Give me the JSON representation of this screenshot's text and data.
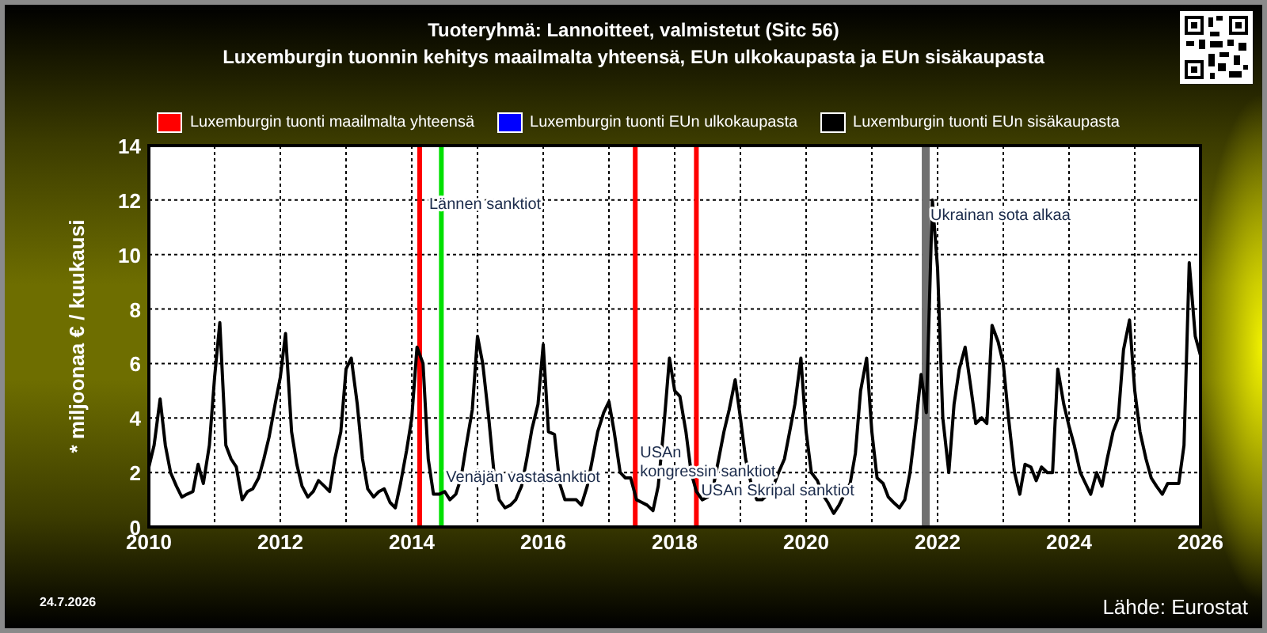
{
  "header": {
    "title": "Tuoteryhmä: Lannoitteet, valmistetut (Sitc 56)",
    "subtitle": "Luxemburgin tuonnin kehitys maailmalta yhteensä, EUn ulkokaupasta ja EUn sisäkaupasta"
  },
  "chart": {
    "chart_data": {
      "type": "line",
      "grid": true,
      "ylabel": "* miljoonaa € / kuukausi",
      "xlim": [
        2010,
        2026
      ],
      "ylim": [
        0,
        14
      ],
      "xticks": [
        2010,
        2012,
        2014,
        2016,
        2018,
        2020,
        2022,
        2024,
        2026
      ],
      "yticks": [
        0,
        2,
        4,
        6,
        8,
        10,
        12,
        14
      ],
      "x": [
        2010,
        2010.08,
        2010.17,
        2010.25,
        2010.33,
        2010.42,
        2010.5,
        2010.58,
        2010.67,
        2010.75,
        2010.83,
        2010.92,
        2011,
        2011.08,
        2011.17,
        2011.25,
        2011.33,
        2011.42,
        2011.5,
        2011.58,
        2011.67,
        2011.75,
        2011.83,
        2011.92,
        2012,
        2012.08,
        2012.17,
        2012.25,
        2012.33,
        2012.42,
        2012.5,
        2012.58,
        2012.67,
        2012.75,
        2012.83,
        2012.92,
        2013,
        2013.08,
        2013.17,
        2013.25,
        2013.33,
        2013.42,
        2013.5,
        2013.58,
        2013.67,
        2013.75,
        2013.83,
        2013.92,
        2014,
        2014.08,
        2014.17,
        2014.25,
        2014.33,
        2014.42,
        2014.5,
        2014.58,
        2014.67,
        2014.75,
        2014.83,
        2014.92,
        2015,
        2015.08,
        2015.17,
        2015.25,
        2015.33,
        2015.42,
        2015.5,
        2015.58,
        2015.67,
        2015.75,
        2015.83,
        2015.92,
        2016,
        2016.08,
        2016.17,
        2016.25,
        2016.33,
        2016.42,
        2016.5,
        2016.58,
        2016.67,
        2016.75,
        2016.83,
        2016.92,
        2017,
        2017.08,
        2017.17,
        2017.25,
        2017.33,
        2017.42,
        2017.5,
        2017.58,
        2017.67,
        2017.75,
        2017.83,
        2017.92,
        2018,
        2018.08,
        2018.17,
        2018.25,
        2018.33,
        2018.42,
        2018.5,
        2018.58,
        2018.67,
        2018.75,
        2018.83,
        2018.92,
        2019,
        2019.08,
        2019.17,
        2019.25,
        2019.33,
        2019.42,
        2019.5,
        2019.58,
        2019.67,
        2019.75,
        2019.83,
        2019.92,
        2020,
        2020.08,
        2020.17,
        2020.25,
        2020.33,
        2020.42,
        2020.5,
        2020.58,
        2020.67,
        2020.75,
        2020.83,
        2020.92,
        2021,
        2021.08,
        2021.17,
        2021.25,
        2021.33,
        2021.42,
        2021.5,
        2021.58,
        2021.67,
        2021.75,
        2021.83,
        2021.92,
        2022,
        2022.08,
        2022.17,
        2022.25,
        2022.33,
        2022.42,
        2022.5,
        2022.58,
        2022.67,
        2022.75,
        2022.83,
        2022.92,
        2023,
        2023.08,
        2023.17,
        2023.25,
        2023.33,
        2023.42,
        2023.5,
        2023.58,
        2023.67,
        2023.75,
        2023.83,
        2023.92,
        2024,
        2024.08,
        2024.17,
        2024.25,
        2024.33,
        2024.42,
        2024.5,
        2024.58,
        2024.67,
        2024.75,
        2024.83,
        2024.92,
        2025,
        2025.08,
        2025.17,
        2025.25,
        2025.33,
        2025.42,
        2025.5,
        2025.58,
        2025.67,
        2025.75,
        2025.83,
        2025.92,
        2026
      ],
      "series": [
        {
          "name": "Luxemburgin tuonti maailmalta yhteensä",
          "color": "#ff0000",
          "values": [
            null,
            null,
            null,
            null,
            null,
            null,
            null,
            null,
            null,
            null,
            null,
            null,
            null,
            null,
            null,
            null,
            null,
            null,
            null,
            null,
            null,
            null,
            null,
            null,
            null,
            null,
            null,
            null,
            null,
            null,
            null,
            null,
            null,
            null,
            null,
            null,
            null,
            null,
            null,
            null,
            null,
            null,
            null,
            null,
            null,
            null,
            null,
            null,
            null,
            null,
            null,
            null,
            null,
            null,
            null,
            null,
            null,
            null,
            null,
            null,
            null,
            null,
            null,
            null,
            null,
            null,
            null,
            null,
            null,
            null,
            null,
            null,
            null,
            null,
            null,
            null,
            null,
            null,
            null,
            null,
            null,
            null,
            null,
            null,
            null,
            null,
            null,
            null,
            null,
            null,
            null,
            null,
            null,
            null,
            null,
            null,
            null,
            null,
            null,
            null,
            null,
            null,
            null,
            null,
            null,
            null,
            null,
            null,
            null,
            null,
            null,
            null,
            null,
            null,
            null,
            null,
            null,
            null,
            null,
            null,
            null,
            null,
            null,
            null,
            null,
            null,
            null,
            null,
            null,
            null,
            null,
            null,
            null,
            null,
            null,
            null,
            null,
            null,
            null,
            null,
            null,
            null,
            null,
            null,
            null,
            null,
            null,
            null,
            null,
            null,
            null,
            null,
            null,
            null,
            null,
            null,
            null,
            null,
            null,
            null,
            null,
            null,
            null,
            null,
            null,
            null,
            null,
            null,
            null,
            null,
            null,
            null,
            null,
            null,
            null,
            null,
            null,
            null,
            null,
            null,
            null,
            null,
            null,
            null,
            null,
            null,
            null,
            null,
            null,
            null,
            null,
            null,
            null
          ]
        },
        {
          "name": "Luxemburgin tuonti EUn ulkokaupasta",
          "color": "#0000ff",
          "values": [
            null,
            null,
            null,
            null,
            null,
            null,
            null,
            null,
            null,
            null,
            null,
            null,
            null,
            null,
            null,
            null,
            null,
            null,
            null,
            null,
            null,
            null,
            null,
            null,
            null,
            null,
            null,
            null,
            null,
            null,
            null,
            null,
            null,
            null,
            null,
            null,
            null,
            null,
            null,
            null,
            null,
            null,
            null,
            null,
            null,
            null,
            null,
            null,
            null,
            null,
            null,
            null,
            null,
            null,
            null,
            null,
            null,
            null,
            null,
            null,
            null,
            null,
            null,
            null,
            null,
            null,
            null,
            null,
            null,
            null,
            null,
            null,
            null,
            null,
            null,
            null,
            null,
            null,
            null,
            null,
            null,
            null,
            null,
            null,
            null,
            null,
            null,
            null,
            null,
            null,
            null,
            null,
            null,
            null,
            null,
            null,
            null,
            null,
            null,
            null,
            null,
            null,
            null,
            null,
            null,
            null,
            null,
            null,
            null,
            null,
            null,
            null,
            null,
            null,
            null,
            null,
            null,
            null,
            null,
            null,
            null,
            null,
            null,
            null,
            null,
            null,
            null,
            null,
            null,
            null,
            null,
            null,
            null,
            null,
            null,
            null,
            null,
            null,
            null,
            null,
            null,
            null,
            null,
            null,
            null,
            null,
            null,
            null,
            null,
            null,
            null,
            null,
            null,
            null,
            null,
            null,
            null,
            null,
            null,
            null,
            null,
            null,
            null,
            null,
            null,
            null,
            null,
            null,
            null,
            null,
            null,
            null,
            null,
            null,
            null,
            null,
            null,
            null,
            null,
            null,
            null,
            null,
            null,
            null,
            null,
            null,
            null,
            null,
            null,
            null,
            null,
            null,
            null
          ]
        },
        {
          "name": "Luxemburgin tuonti EUn sisäkaupasta",
          "color": "#000000",
          "values": [
            2.2,
            3.0,
            4.7,
            3.0,
            2.0,
            1.5,
            1.1,
            1.2,
            1.3,
            2.3,
            1.6,
            3.0,
            5.5,
            7.5,
            3.0,
            2.5,
            2.2,
            1.0,
            1.3,
            1.4,
            1.8,
            2.5,
            3.3,
            4.5,
            5.5,
            7.1,
            3.5,
            2.3,
            1.5,
            1.1,
            1.3,
            1.7,
            1.5,
            1.3,
            2.5,
            3.5,
            5.8,
            6.2,
            4.5,
            2.5,
            1.4,
            1.1,
            1.3,
            1.4,
            0.9,
            0.7,
            1.6,
            2.8,
            4.0,
            6.6,
            6.0,
            2.5,
            1.2,
            1.2,
            1.3,
            1.0,
            1.2,
            1.8,
            3.0,
            4.3,
            7.0,
            6.0,
            4.0,
            2.0,
            1.0,
            0.7,
            0.8,
            1.0,
            1.5,
            2.5,
            3.6,
            4.5,
            6.7,
            3.5,
            3.4,
            1.6,
            1.0,
            1.0,
            1.0,
            0.8,
            1.5,
            2.5,
            3.5,
            4.2,
            4.6,
            3.5,
            2.0,
            1.8,
            1.8,
            1.0,
            0.9,
            0.8,
            0.6,
            1.5,
            3.5,
            6.2,
            5.0,
            4.8,
            3.5,
            2.0,
            1.3,
            1.0,
            1.1,
            1.4,
            2.5,
            3.5,
            4.3,
            5.4,
            4.0,
            2.5,
            1.5,
            1.0,
            1.0,
            1.2,
            1.5,
            2.0,
            2.5,
            3.5,
            4.5,
            6.2,
            3.5,
            2.0,
            1.7,
            1.2,
            0.9,
            0.5,
            0.8,
            1.2,
            1.6,
            2.7,
            5.0,
            6.2,
            3.5,
            1.8,
            1.6,
            1.1,
            0.9,
            0.7,
            1.0,
            2.0,
            3.8,
            5.6,
            4.2,
            12.0,
            9.5,
            4.0,
            2.0,
            4.5,
            5.8,
            6.6,
            5.2,
            3.8,
            4.0,
            3.8,
            7.4,
            6.8,
            6.0,
            4.0,
            2.0,
            1.2,
            2.3,
            2.2,
            1.7,
            2.2,
            2.0,
            2.0,
            5.8,
            4.5,
            3.7,
            3.0,
            2.0,
            1.6,
            1.2,
            2.0,
            1.5,
            2.5,
            3.5,
            4.0,
            6.5,
            7.6,
            5.0,
            3.5,
            2.5,
            1.8,
            1.5,
            1.2,
            1.6,
            1.6,
            1.6,
            3.0,
            9.7,
            7.0,
            6.3
          ]
        }
      ],
      "ref_lines": [
        {
          "axis": "x",
          "value": 2014.12,
          "color": "#ff0000",
          "label": "Lännen sanktiot"
        },
        {
          "axis": "x",
          "value": 2014.45,
          "color": "#00e000",
          "label": "Venäjän vastasanktiot"
        },
        {
          "axis": "x",
          "value": 2017.4,
          "color": "#ff0000",
          "label": "USAn\nkongressin sanktiot"
        },
        {
          "axis": "x",
          "value": 2018.33,
          "color": "#ff0000",
          "label": "USAn Skripal sanktiot"
        },
        {
          "axis": "x",
          "value": 2021.82,
          "color": "#707070",
          "label": "Ukrainan sota alkaa"
        }
      ]
    }
  },
  "footer": {
    "date": "24.7.2026",
    "source": "Lähde: Eurostat"
  }
}
